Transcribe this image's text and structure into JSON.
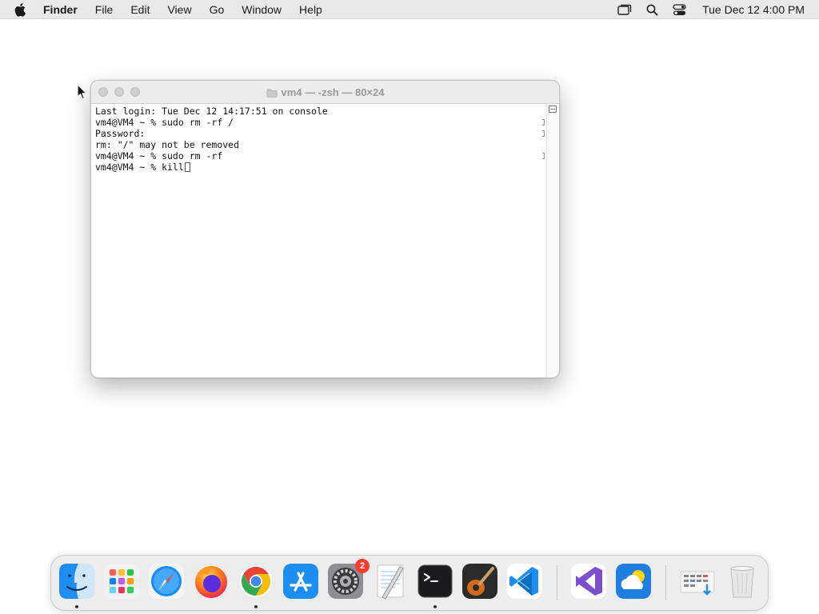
{
  "menubar": {
    "apple_icon": "apple-logo-icon",
    "app_name": "Finder",
    "items": [
      "File",
      "Edit",
      "View",
      "Go",
      "Window",
      "Help"
    ],
    "status_icons": [
      "screen-mirroring-icon",
      "spotlight-search-icon",
      "control-center-icon"
    ],
    "clock": "Tue Dec 12  4:00 PM"
  },
  "terminal": {
    "title": "vm4 — -zsh — 80×24",
    "lines": [
      "Last login: Tue Dec 12 14:17:51 on console",
      "vm4@VM4 ~ % sudo rm -rf /",
      "Password:",
      "rm: \"/\" may not be removed",
      "vm4@VM4 ~ % sudo rm -rf"
    ],
    "current_prompt": "vm4@VM4 ~ % kill"
  },
  "dock": {
    "apps": [
      {
        "name": "Finder",
        "icon": "finder-icon",
        "running": true
      },
      {
        "name": "Launchpad",
        "icon": "launchpad-icon",
        "running": false
      },
      {
        "name": "Safari",
        "icon": "safari-icon",
        "running": false
      },
      {
        "name": "Firefox",
        "icon": "firefox-icon",
        "running": false
      },
      {
        "name": "Google Chrome",
        "icon": "chrome-icon",
        "running": true
      },
      {
        "name": "App Store",
        "icon": "app-store-icon",
        "running": false
      },
      {
        "name": "System Settings",
        "icon": "system-settings-icon",
        "running": false,
        "badge": "2"
      },
      {
        "name": "TextEdit",
        "icon": "textedit-icon",
        "running": false
      },
      {
        "name": "Terminal",
        "icon": "terminal-icon",
        "running": true
      },
      {
        "name": "Instruments",
        "icon": "guitar-icon",
        "running": false
      },
      {
        "name": "Visual Studio Code",
        "icon": "vscode-icon",
        "running": false
      },
      {
        "name": "Visual Studio",
        "icon": "visual-studio-icon",
        "running": false
      },
      {
        "name": "Weather",
        "icon": "weather-icon",
        "running": false
      },
      {
        "name": "Downloads",
        "icon": "downloads-stack-icon",
        "running": false
      },
      {
        "name": "Trash",
        "icon": "trash-icon",
        "running": false
      }
    ]
  }
}
